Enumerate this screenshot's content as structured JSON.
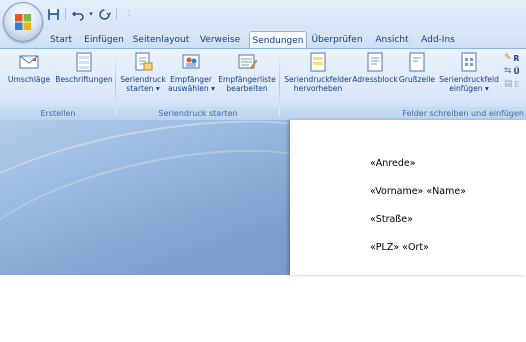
{
  "tabs": [
    "Start",
    "Einfügen",
    "Seitenlayout",
    "Verweise",
    "Sendungen",
    "Überprüfen",
    "Ansicht",
    "Add-Ins"
  ],
  "active_tab": "Sendungen",
  "groups": {
    "erstellen": {
      "label": "Erstellen",
      "buttons": [
        "Umschläge",
        "Beschriftungen"
      ]
    },
    "seriendruck": {
      "label": "Seriendruck starten",
      "buttons": [
        {
          "line1": "Seriendruck",
          "line2": "starten ▾"
        },
        {
          "line1": "Empfänger",
          "line2": "auswählen ▾"
        },
        {
          "line1": "Empfängerliste",
          "line2": "bearbeiten"
        }
      ]
    },
    "felder": {
      "label": "Felder schreiben und einfügen",
      "buttons": [
        {
          "line1": "Seriendruckfelder",
          "line2": "hervorheben"
        },
        {
          "line1": "Adressblock",
          "line2": ""
        },
        {
          "line1": "Grußzeile",
          "line2": ""
        },
        {
          "line1": "Seriendruckfeld",
          "line2": "einfügen ▾"
        }
      ],
      "small_buttons": [
        "R",
        "Ü",
        "E"
      ]
    }
  },
  "document": {
    "lines": [
      "«Anrede»",
      "«Vorname» «Name»",
      "«Straße»",
      "«PLZ» «Ort»"
    ]
  },
  "colors": {
    "ribbon_text": "#15428b",
    "group_label": "#3e6aaa",
    "accent": "#8db2e3"
  }
}
